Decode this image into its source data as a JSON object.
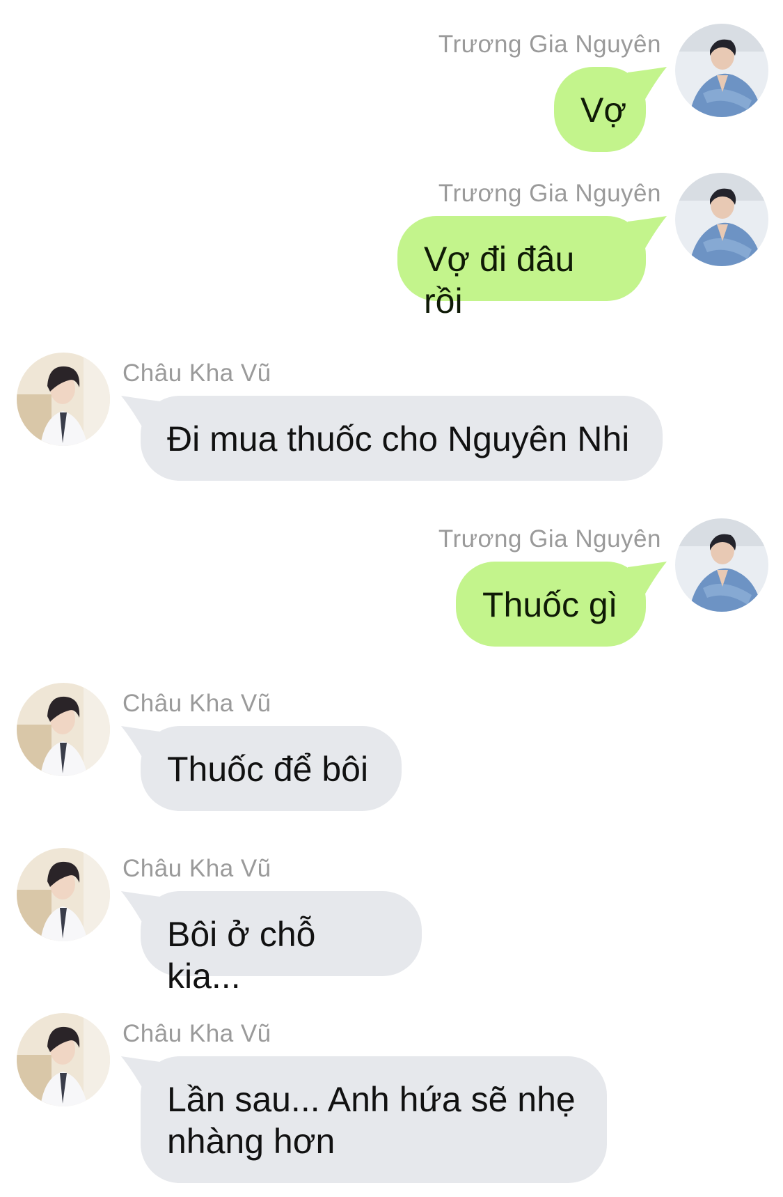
{
  "colors": {
    "outgoing_bubble": "#c3f48c",
    "incoming_bubble": "#e6e8ec",
    "sender_name": "#9a9a9a",
    "background": "#ffffff"
  },
  "messages": [
    {
      "side": "right",
      "sender": "Trương Gia Nguyên",
      "text": "Vợ",
      "avatar": "avatar-photo-icon"
    },
    {
      "side": "right",
      "sender": "Trương Gia Nguyên",
      "text": "Vợ đi đâu rồi",
      "avatar": "avatar-photo-icon"
    },
    {
      "side": "left",
      "sender": "Châu Kha Vũ",
      "text": "Đi mua thuốc cho Nguyên Nhi",
      "avatar": "avatar-photo-icon"
    },
    {
      "side": "right",
      "sender": "Trương Gia Nguyên",
      "text": "Thuốc gì",
      "avatar": "avatar-photo-icon"
    },
    {
      "side": "left",
      "sender": "Châu Kha Vũ",
      "text": "Thuốc để bôi",
      "avatar": "avatar-photo-icon"
    },
    {
      "side": "left",
      "sender": "Châu Kha Vũ",
      "text": "Bôi ở chỗ kia...",
      "avatar": "avatar-photo-icon"
    },
    {
      "side": "left",
      "sender": "Châu Kha Vũ",
      "text": "Lần sau... Anh hứa sẽ nhẹ nhàng hơn",
      "avatar": "avatar-photo-icon"
    }
  ]
}
